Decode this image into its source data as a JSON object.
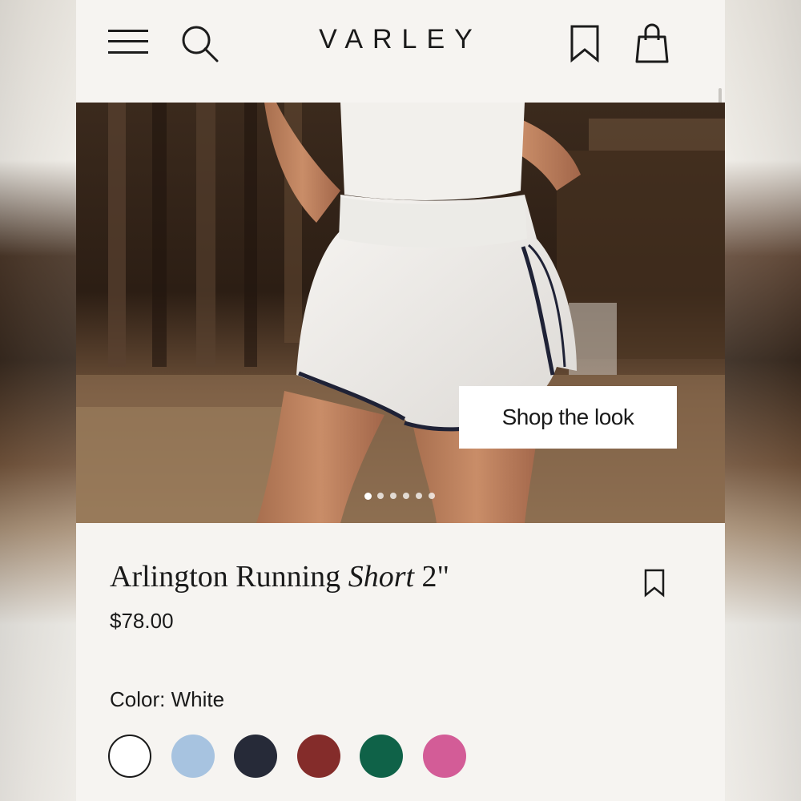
{
  "header": {
    "brand": "VARLEY",
    "icons": [
      "menu-icon",
      "search-icon",
      "bookmark-icon",
      "shopping-bag-icon"
    ]
  },
  "hero": {
    "cta_label": "Shop the look",
    "carousel": {
      "total": 6,
      "active": 1
    }
  },
  "product": {
    "title_regular": "Arlington Running ",
    "title_italic": "Short",
    "title_suffix": " 2\"",
    "price": "$78.00",
    "color_label": "Color: White",
    "swatches": [
      {
        "name": "White",
        "color": "#ffffff",
        "selected": true
      },
      {
        "name": "Light Blue",
        "color": "#a7c3e0",
        "selected": false
      },
      {
        "name": "Navy",
        "color": "#262a38",
        "selected": false
      },
      {
        "name": "Burgundy",
        "color": "#842c2a",
        "selected": false
      },
      {
        "name": "Green",
        "color": "#0f6248",
        "selected": false
      },
      {
        "name": "Pink",
        "color": "#d35c97",
        "selected": false
      }
    ]
  }
}
